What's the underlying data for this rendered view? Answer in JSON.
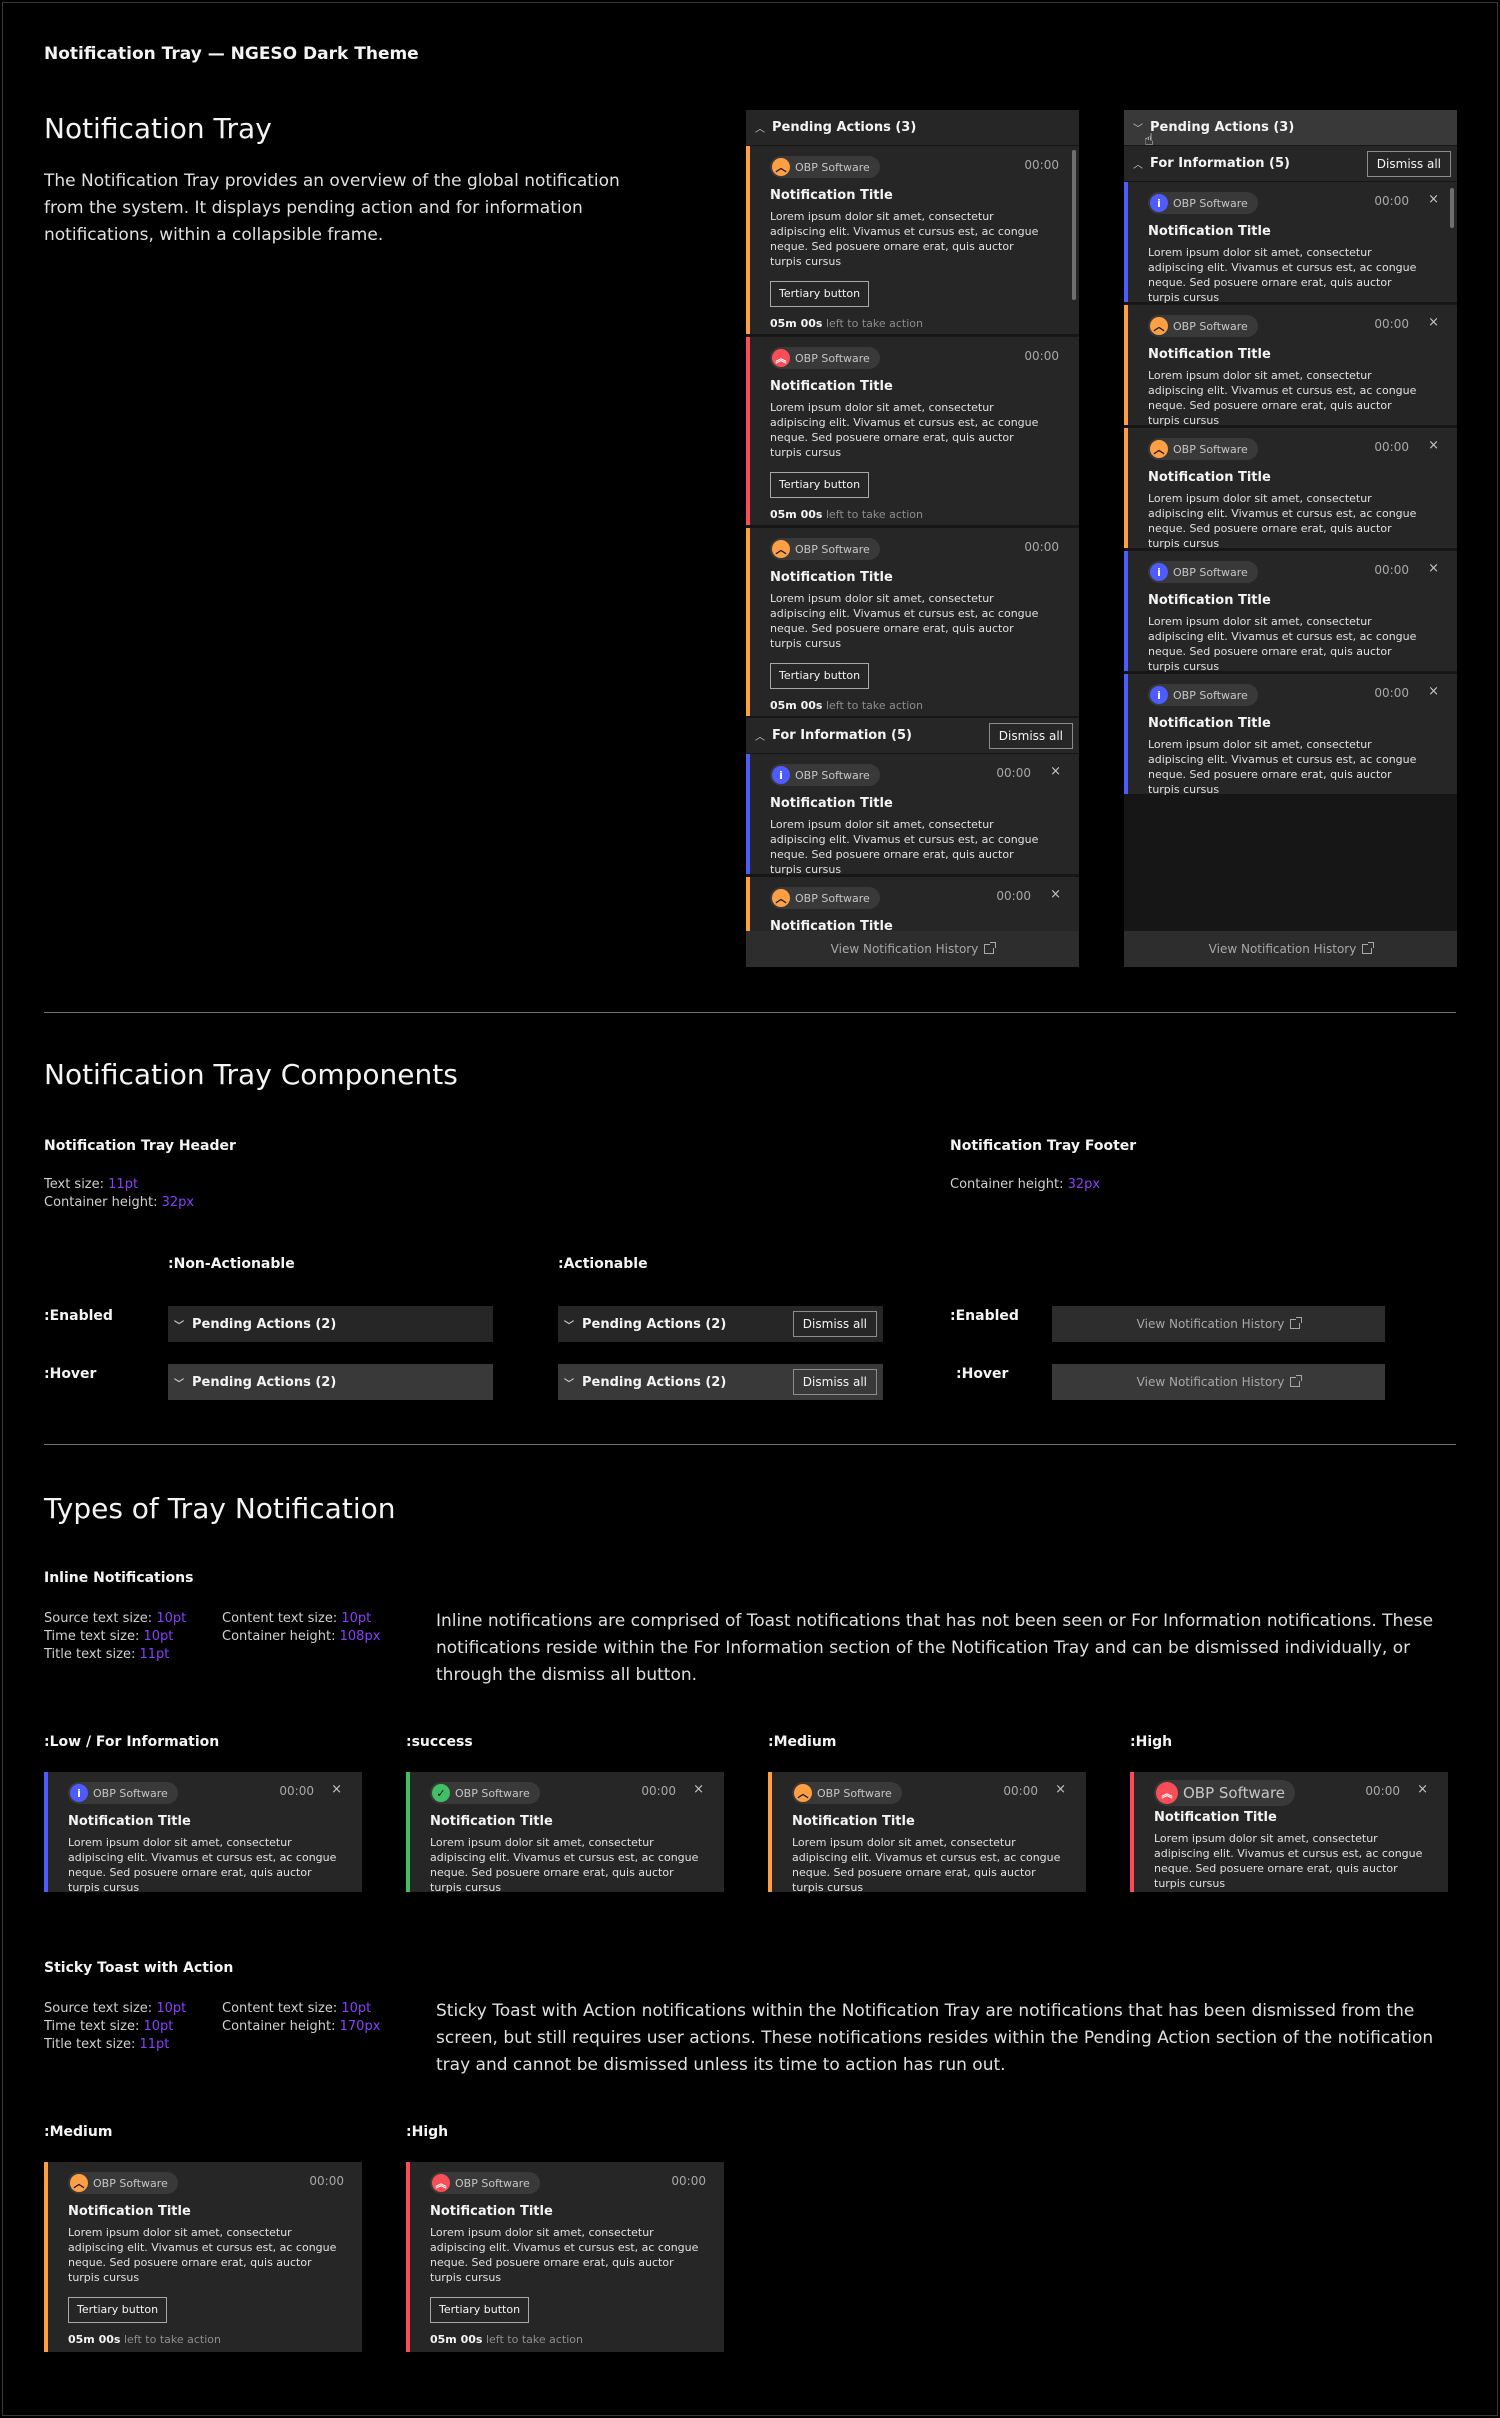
{
  "page_label": "Notification Tray — NGESO Dark Theme",
  "intro": {
    "title": "Notification Tray",
    "description": "The Notification Tray provides an overview of the global notification from the system. It displays pending action and for information notifications, within a collapsible frame."
  },
  "common": {
    "source": "OBP Software",
    "time": "00:00",
    "notif_title": "Notification Title",
    "notif_body": "Lorem ipsum dolor sit amet, consectetur adipiscing elit. Vivamus et cursus est, ac congue neque. Sed posuere ornare erat, quis auctor turpis cursus",
    "tertiary": "Tertiary button",
    "countdown": "05m 00s",
    "countdown_suffix": "left to take action",
    "dismiss_all": "Dismiss all",
    "footer": "View Notification History",
    "close": "×"
  },
  "tray1": {
    "pending_header": "Pending Actions (3)",
    "info_header": "For Information (5)",
    "partial_title": "Notification Title"
  },
  "tray2": {
    "pending_header": "Pending Actions (3)",
    "info_header": "For Information (5)"
  },
  "components": {
    "title": "Notification Tray Components",
    "header_title": "Notification Tray Header",
    "header_spec1_label": "Text size:",
    "header_spec1_value": "11pt",
    "header_spec2_label": "Container height:",
    "header_spec2_value": "32px",
    "footer_title": "Notification Tray Footer",
    "footer_spec_label": "Container height:",
    "footer_spec_value": "32px",
    "col_non_actionable": ":Non-Actionable",
    "col_actionable": ":Actionable",
    "row_enabled": ":Enabled",
    "row_hover": ":Hover",
    "pending2": "Pending Actions (2)"
  },
  "types": {
    "title": "Types of Tray Notification",
    "inline_title": "Inline Notifications",
    "inline_specs": {
      "source_label": "Source text size:",
      "source_value": "10pt",
      "time_label": "Time text size:",
      "time_value": "10pt",
      "title_label": "Title text size:",
      "title_value": "11pt",
      "content_label": "Content text size:",
      "content_value": "10pt",
      "height_label": "Container height:",
      "height_value": "108px"
    },
    "inline_desc": "Inline notifications are comprised of Toast notifications that has not been seen or For Information notifications. These notifications reside within the For Information section of the Notification Tray and can be dismissed individually, or through the dismiss all button.",
    "inline_states": [
      ":Low / For Information",
      ":success",
      ":Medium",
      ":High"
    ],
    "sticky_title": "Sticky Toast with Action",
    "sticky_specs": {
      "source_label": "Source text size:",
      "source_value": "10pt",
      "time_label": "Time text size:",
      "time_value": "10pt",
      "title_label": "Title text size:",
      "title_value": "11pt",
      "content_label": "Content text size:",
      "content_value": "10pt",
      "height_label": "Container height:",
      "height_value": "170px"
    },
    "sticky_desc": "Sticky Toast with Action notifications within the Notification Tray are notifications that has been dismissed from the screen, but still requires user actions. These notifications resides within the Pending Action section of the notification tray and cannot be dismissed unless its time to action has run out.",
    "sticky_states": [
      ":Medium",
      ":High"
    ]
  },
  "colors": {
    "info": "#4d5bff",
    "success": "#42be65",
    "medium": "#ff9f43",
    "high": "#fa4d56",
    "accent_spec": "#8a3ffc"
  }
}
